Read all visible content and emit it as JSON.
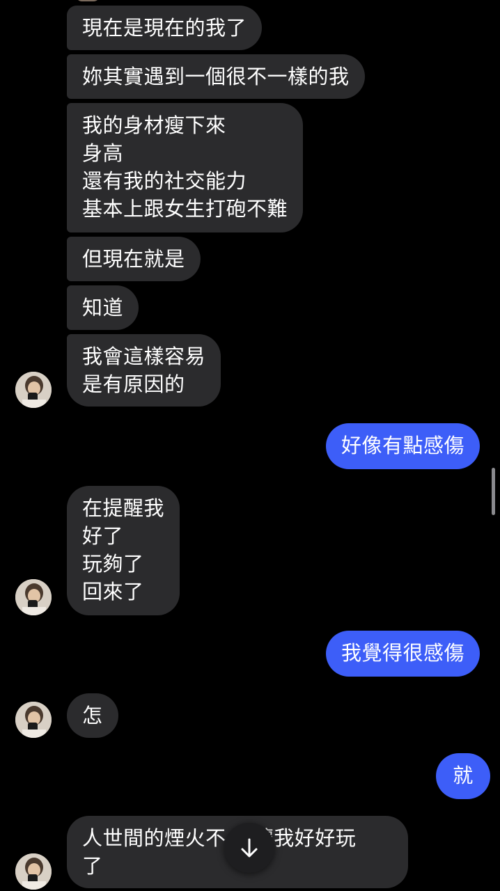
{
  "messages": [
    {
      "id": "m1",
      "side": "received",
      "text": "現在是現在的我了"
    },
    {
      "id": "m2",
      "side": "received",
      "text": "妳其實遇到一個很不一樣的我"
    },
    {
      "id": "m3",
      "side": "received",
      "text": "我的身材瘦下來\n身高\n還有我的社交能力\n基本上跟女生打砲不難"
    },
    {
      "id": "m4",
      "side": "received",
      "text": "但現在就是"
    },
    {
      "id": "m5",
      "side": "received",
      "text": "知道"
    },
    {
      "id": "m6",
      "side": "received",
      "text": "我會這樣容易\n是有原因的"
    },
    {
      "id": "m7",
      "side": "sent",
      "text": "好像有點感傷"
    },
    {
      "id": "m8",
      "side": "received",
      "text": "在提醒我\n好了\n玩夠了\n回來了"
    },
    {
      "id": "m9",
      "side": "sent",
      "text": "我覺得很感傷"
    },
    {
      "id": "m10",
      "side": "received",
      "text": "怎"
    },
    {
      "id": "m11",
      "side": "sent",
      "text": "就"
    },
    {
      "id": "m12",
      "side": "received",
      "text": "人世間的煙火不 再讓我好好玩\n了"
    }
  ],
  "colors": {
    "background": "#000000",
    "received_bubble": "#2b2b2d",
    "sent_bubble": "#3d5ef8",
    "text": "#ffffff"
  },
  "icons": {
    "avatar": "contact-avatar",
    "scroll_down": "arrow-down-icon"
  }
}
